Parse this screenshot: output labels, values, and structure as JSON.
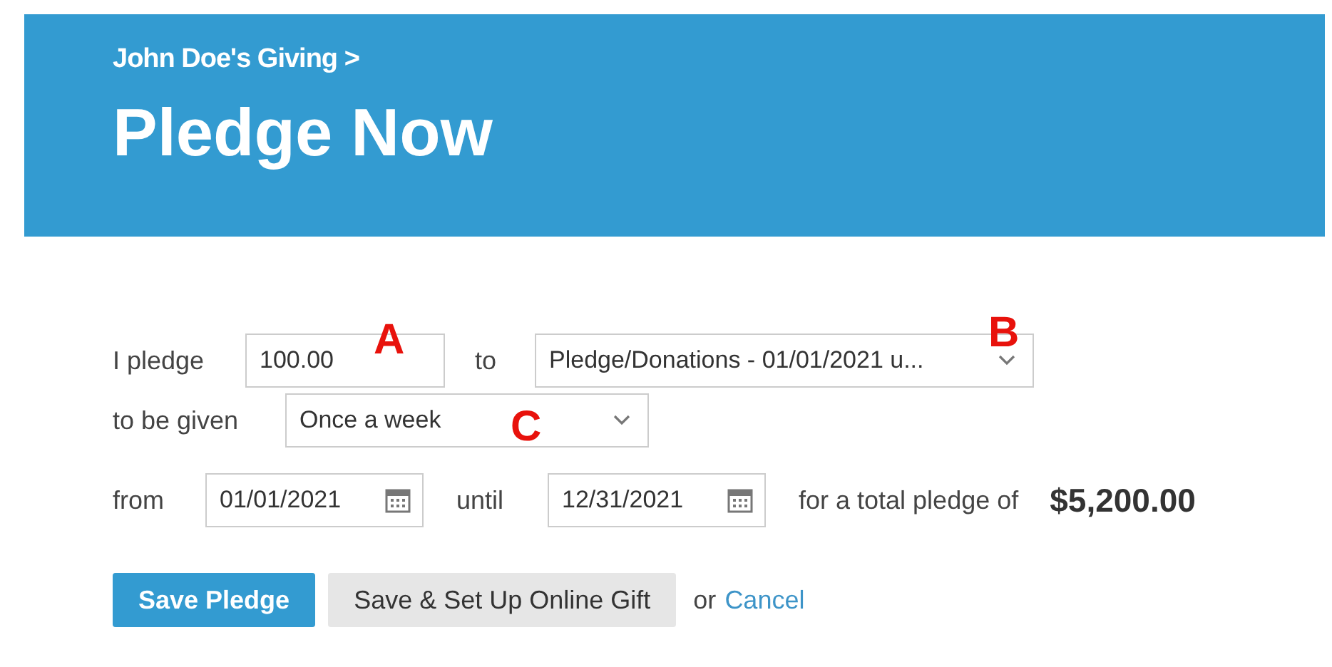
{
  "breadcrumb": "John Doe's Giving >",
  "title": "Pledge Now",
  "form": {
    "pledge_label": "I pledge",
    "amount": "100.00",
    "to_label": "to",
    "fund": "Pledge/Donations - 01/01/2021 u...",
    "frequency_label": "to be given",
    "frequency": "Once a week",
    "from_label": "from",
    "start_date": "01/01/2021",
    "until_label": "until",
    "end_date": "12/31/2021",
    "total_label": "for a total pledge of",
    "total": "$5,200.00"
  },
  "buttons": [
    {
      "label": "Save Pledge",
      "kind": "primary"
    },
    {
      "label": "Save & Set Up Online Gift",
      "kind": "secondary"
    }
  ],
  "or_text": "or",
  "cancel_link": "Cancel",
  "annotations": [
    {
      "label": "A"
    },
    {
      "label": "B"
    },
    {
      "label": "C"
    }
  ]
}
